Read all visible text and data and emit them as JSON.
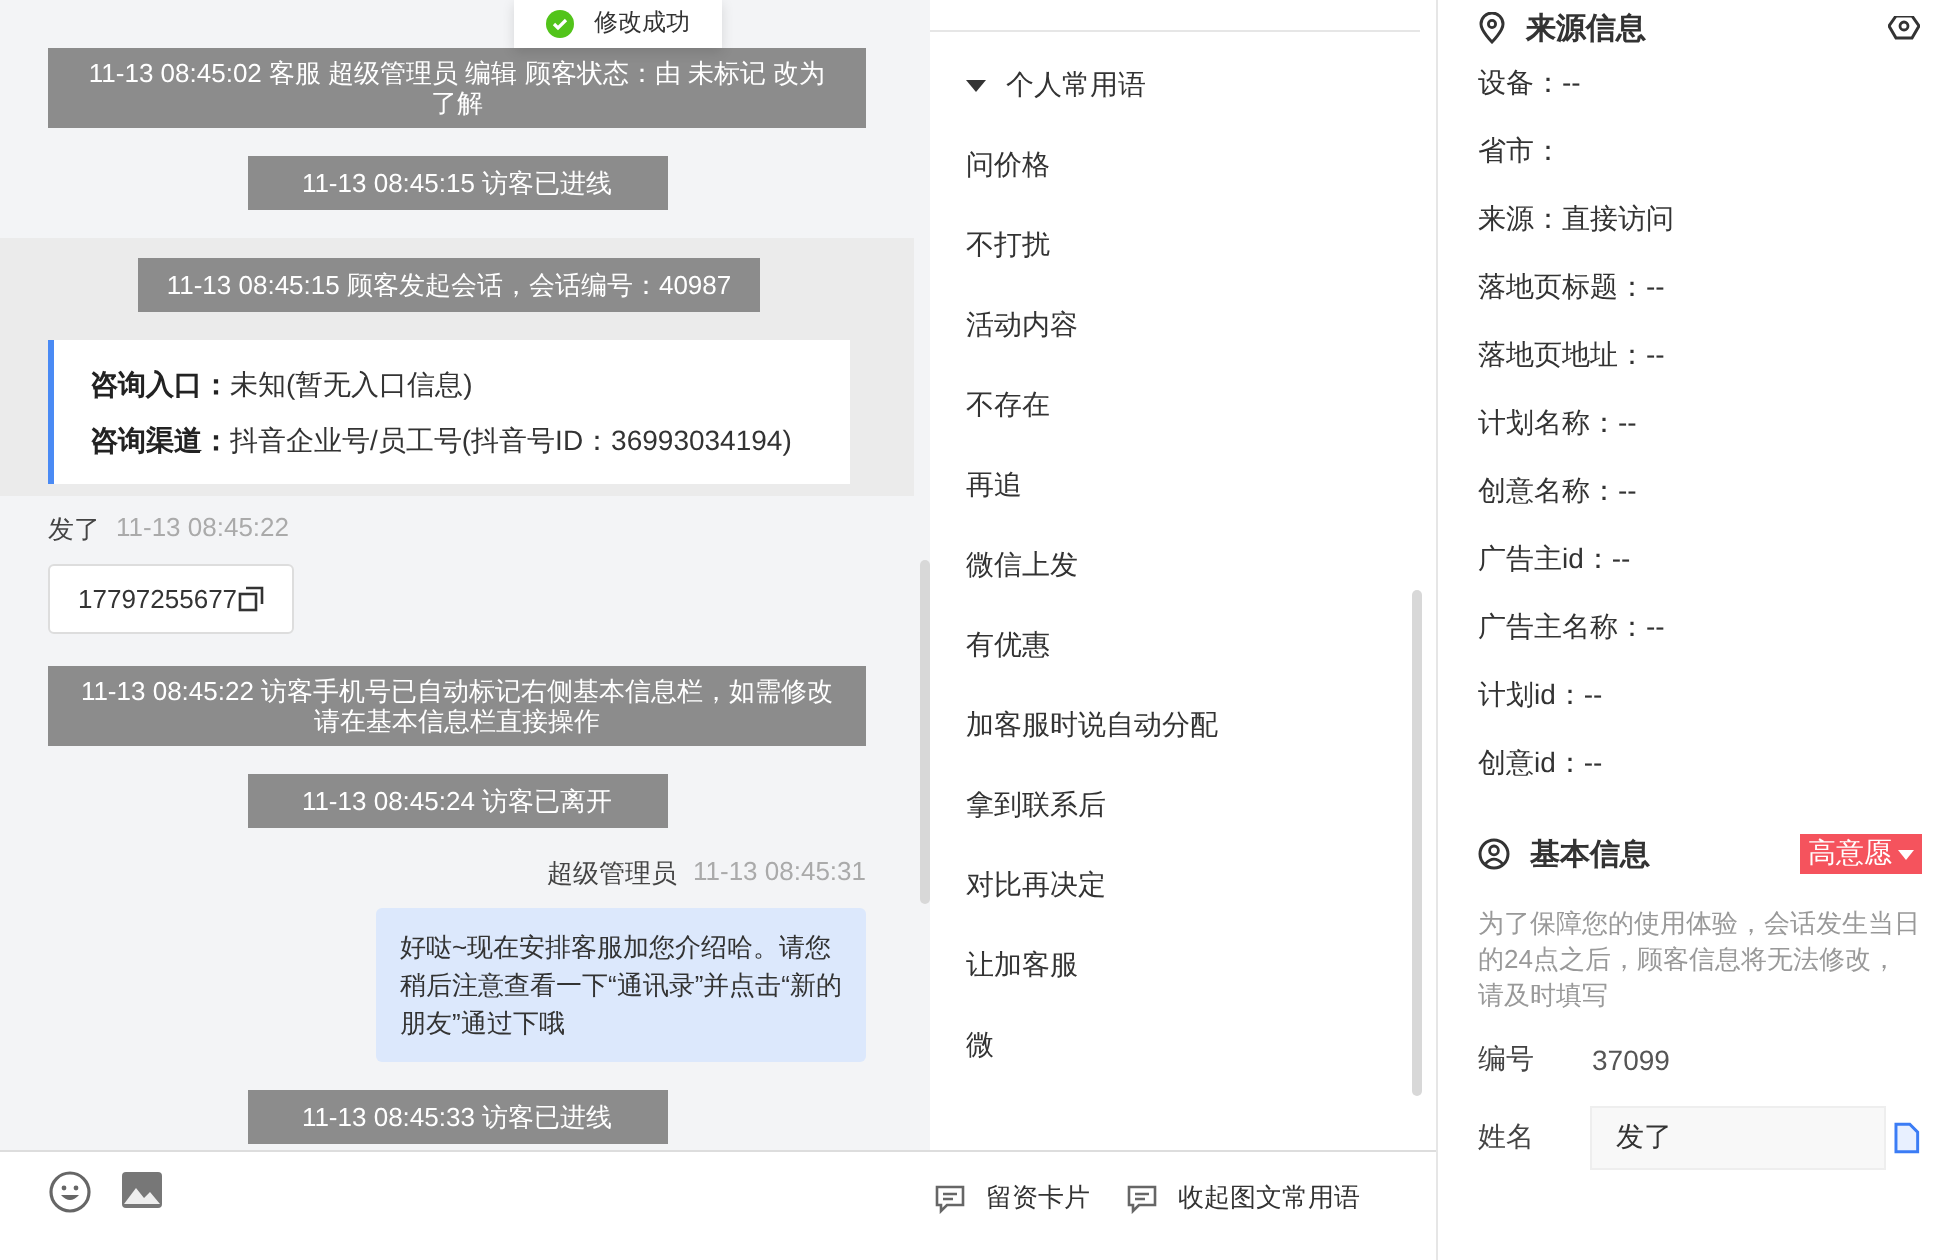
{
  "toast": {
    "text": "修改成功"
  },
  "chat": {
    "messages": [
      {
        "kind": "system",
        "text": "11-13 08:45:02 客服 超级管理员 编辑 顾客状态：由 未标记 改为了解",
        "wide": true
      },
      {
        "kind": "system",
        "text": "11-13 08:45:15 访客已进线"
      },
      {
        "kind": "session",
        "text": "11-13 08:45:15 顾客发起会话，会话编号：40987",
        "fields": [
          {
            "label": "咨询入口：",
            "value": "未知(暂无入口信息)"
          },
          {
            "label": "咨询渠道：",
            "value": "抖音企业号/员工号(抖音号ID：36993034194)"
          }
        ]
      },
      {
        "kind": "visitor",
        "sender": "发了",
        "time": "11-13 08:45:22",
        "text": "17797255677"
      },
      {
        "kind": "system",
        "text": "11-13 08:45:22 访客手机号已自动标记右侧基本信息栏，如需修改请在基本信息栏直接操作",
        "wide": true
      },
      {
        "kind": "system",
        "text": "11-13 08:45:24 访客已离开"
      },
      {
        "kind": "agent",
        "sender": "超级管理员",
        "time": "11-13 08:45:31",
        "text": "好哒~现在安排客服加您介绍哈。请您稍后注意查看一下“通讯录”并点击“新的朋友”通过下哦"
      },
      {
        "kind": "system",
        "text": "11-13 08:45:33 访客已进线"
      }
    ]
  },
  "phrases": {
    "group": "个人常用语",
    "expanded": true,
    "items": [
      "问价格",
      "不打扰",
      "活动内容",
      "不存在",
      "再追",
      "微信上发",
      "有优惠",
      "加客服时说自动分配",
      "拿到联系后",
      "对比再决定",
      "让加客服",
      "微"
    ]
  },
  "toolbar": {
    "buttons": [
      "留资卡片",
      "收起图文常用语"
    ]
  },
  "source_info": {
    "title": "来源信息",
    "rows": [
      "设备：--",
      "省市：",
      "来源：直接访问",
      "落地页标题：--",
      "落地页地址：--",
      "计划名称：--",
      "创意名称：--",
      "广告主id：--",
      "广告主名称：--",
      "计划id：--",
      "创意id：--"
    ]
  },
  "basic_info": {
    "title": "基本信息",
    "tag": "高意愿",
    "notice": "为了保障您的使用体验，会话发生当日的24点之后，顾客信息将无法修改，请及时填写",
    "fields": [
      {
        "label": "编号",
        "value": "37099",
        "kind": "text"
      },
      {
        "label": "姓名",
        "value": "发了",
        "kind": "input"
      }
    ]
  }
}
